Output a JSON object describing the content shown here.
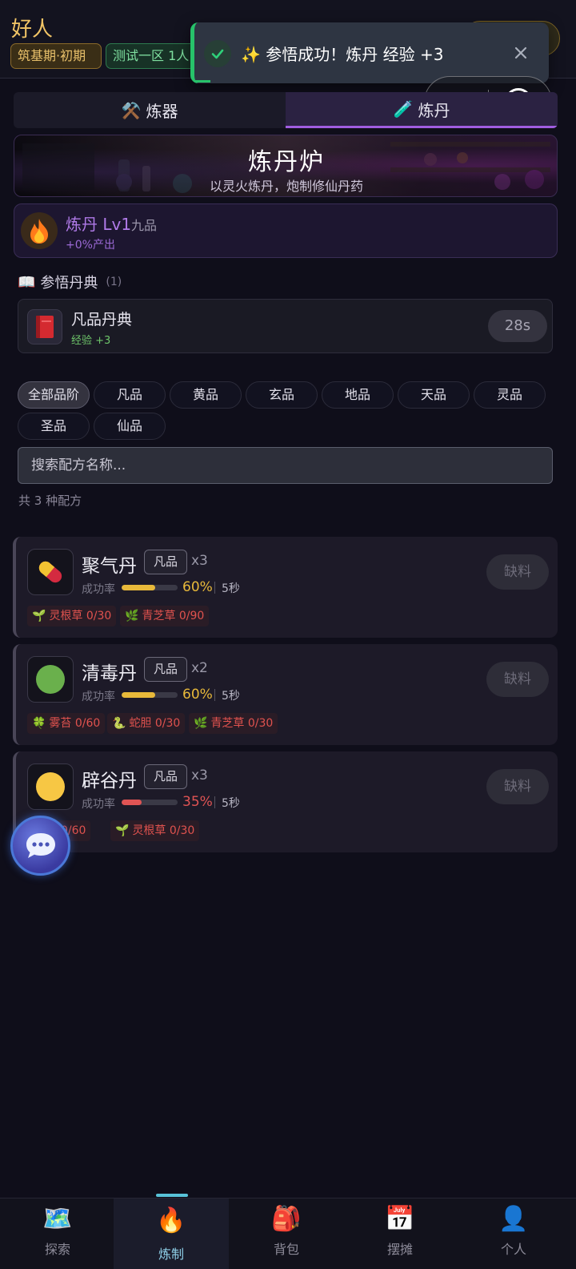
{
  "header": {
    "player_name": "好人",
    "realm": "筑基期·初期",
    "server": "测试一区 1人"
  },
  "toast": {
    "message": "✨ 参悟成功！炼丹 经验 +3"
  },
  "tabs": [
    {
      "label": "炼器",
      "icon": "hammer-pick-icon"
    },
    {
      "label": "炼丹",
      "icon": "test-tube-icon"
    }
  ],
  "banner": {
    "title": "炼丹炉",
    "subtitle": "以灵火炼丹，炮制修仙丹药"
  },
  "level": {
    "name": "炼丹 Lv1",
    "grade": "九品",
    "output": "+0%产出"
  },
  "manual": {
    "section_title": "参悟丹典",
    "count": "(1)",
    "name": "凡品丹典",
    "exp": "经验 +3",
    "timer": "28s"
  },
  "filters": [
    "全部品阶",
    "凡品",
    "黄品",
    "玄品",
    "地品",
    "天品",
    "灵品",
    "圣品",
    "仙品"
  ],
  "search": {
    "placeholder": "搜索配方名称..."
  },
  "recipe_count": "共 3 种配方",
  "recipes": [
    {
      "name": "聚气丹",
      "grade": "凡品",
      "qty": "x3",
      "rate_label": "成功率",
      "rate": "60%",
      "rate_value": 0.6,
      "rate_color": "#e8b93a",
      "time": "5秒",
      "button": "缺料",
      "materials": [
        {
          "text": "灵根草 0/30",
          "icon": "seedling-icon"
        },
        {
          "text": "青芝草 0/90",
          "icon": "herb-icon"
        }
      ]
    },
    {
      "name": "清毒丹",
      "grade": "凡品",
      "qty": "x2",
      "rate_label": "成功率",
      "rate": "60%",
      "rate_value": 0.6,
      "rate_color": "#e8b93a",
      "time": "5秒",
      "button": "缺料",
      "materials": [
        {
          "text": "雾苔 0/60",
          "icon": "clover-icon"
        },
        {
          "text": "蛇胆 0/30",
          "icon": "snake-icon"
        },
        {
          "text": "青芝草 0/30",
          "icon": "herb-icon"
        }
      ]
    },
    {
      "name": "辟谷丹",
      "grade": "凡品",
      "qty": "x3",
      "rate_label": "成功率",
      "rate": "35%",
      "rate_value": 0.35,
      "rate_color": "#e05454",
      "time": "5秒",
      "button": "缺料",
      "materials": [
        {
          "text": "0/60",
          "icon": "mushroom-icon"
        },
        {
          "text": "灵根草 0/30",
          "icon": "seedling-icon"
        }
      ]
    }
  ],
  "nav": [
    {
      "label": "探索",
      "icon": "map-icon"
    },
    {
      "label": "炼制",
      "icon": "fire-icon"
    },
    {
      "label": "背包",
      "icon": "backpack-icon"
    },
    {
      "label": "摆摊",
      "icon": "calendar-icon"
    },
    {
      "label": "个人",
      "icon": "person-icon"
    }
  ],
  "colors": {
    "accent": "#a05de0",
    "gold": "#f2c566",
    "success": "#27c26a",
    "missing": "#e0524e"
  }
}
